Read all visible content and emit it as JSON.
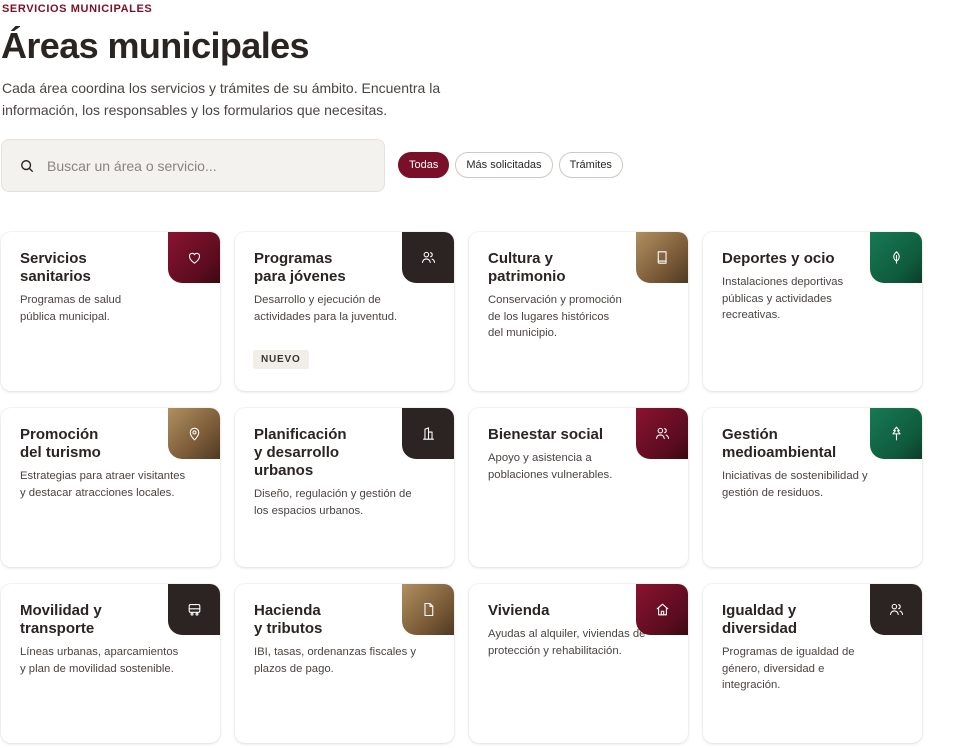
{
  "header": {
    "eyebrow": "SERVICIOS MUNICIPALES",
    "title": "Áreas municipales",
    "intro": "Cada área coordina los servicios y trámites de su ámbito. Encuentra la información, los responsables y los formularios que necesitas."
  },
  "search": {
    "placeholder": "Buscar un área o servicio...",
    "value": ""
  },
  "filters": {
    "all": "Todas",
    "popular": "Más solicitadas",
    "procedures": "Trámites",
    "active": "Todas"
  },
  "colors": {
    "brand": "#7a1027",
    "wine": "#8a1330",
    "dark": "#2b2422",
    "gold": "#b09060",
    "green": "#167a55"
  },
  "cards": [
    {
      "title": "Servicios\nsanitarios",
      "desc": "Programas de salud\npública municipal.",
      "icon": "heart-icon",
      "color": "wine"
    },
    {
      "title": "Programas\npara jóvenes",
      "desc": "Desarrollo y ejecución de\nactividades para la juventud.",
      "icon": "users-icon",
      "color": "dark",
      "badge": "NUEVO"
    },
    {
      "title": "Cultura y\npatrimonio",
      "desc": "Conservación y promoción\nde los lugares históricos\ndel municipio.",
      "icon": "book-icon",
      "color": "gold"
    },
    {
      "title": "Deportes y ocio",
      "desc": "Instalaciones deportivas\npúblicas y actividades\nrecreativas.",
      "icon": "leaf-icon",
      "color": "green"
    },
    {
      "title": "Promoción\ndel turismo",
      "desc": "Estrategias para atraer visitantes\ny destacar atracciones locales.",
      "icon": "map-pin-icon",
      "color": "gold"
    },
    {
      "title": "Planificación\ny desarrollo\nurbanos",
      "desc": "Diseño, regulación y gestión de\nlos espacios urbanos.",
      "icon": "building-icon",
      "color": "dark"
    },
    {
      "title": "Bienestar social",
      "desc": "Apoyo y asistencia a\npoblaciones vulnerables.",
      "icon": "users-icon",
      "color": "wine"
    },
    {
      "title": "Gestión\nmedioambiental",
      "desc": "Iniciativas de sostenibilidad y\ngestión de residuos.",
      "icon": "tree-icon",
      "color": "green"
    },
    {
      "title": "Movilidad y\ntransporte",
      "desc": "Líneas urbanas, aparcamientos\ny plan de movilidad sostenible.",
      "icon": "bus-icon",
      "color": "dark"
    },
    {
      "title": "Hacienda\ny tributos",
      "desc": "IBI, tasas, ordenanzas fiscales y\nplazos de pago.",
      "icon": "file-icon",
      "color": "gold"
    },
    {
      "title": "Vivienda",
      "desc": "Ayudas al alquiler, viviendas de\nprotección y rehabilitación.",
      "icon": "home-icon",
      "color": "wine"
    },
    {
      "title": "Igualdad y\ndiversidad",
      "desc": "Programas de igualdad de\ngénero, diversidad e\nintegración.",
      "icon": "users-icon",
      "color": "dark"
    }
  ]
}
